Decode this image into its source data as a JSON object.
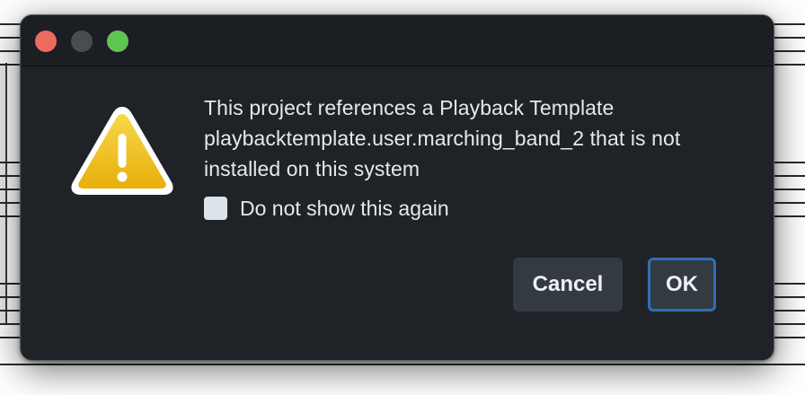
{
  "dialog": {
    "window_controls": {
      "close": "close-button",
      "minimize": "minimize-button",
      "zoom": "zoom-button"
    },
    "icon": "warning-icon",
    "message_lines": [
      "This project references a Playback Template",
      "playbacktemplate.user.marching_band_2 that is not",
      "installed on this system"
    ],
    "checkbox": {
      "label": "Do not show this again",
      "checked": false
    },
    "buttons": {
      "cancel": "Cancel",
      "ok": "OK"
    },
    "colors": {
      "background": "#1f2328",
      "text": "#e6e8eb",
      "default_button_border": "#2f6fb3",
      "warning_fill": "#f2c316"
    }
  }
}
